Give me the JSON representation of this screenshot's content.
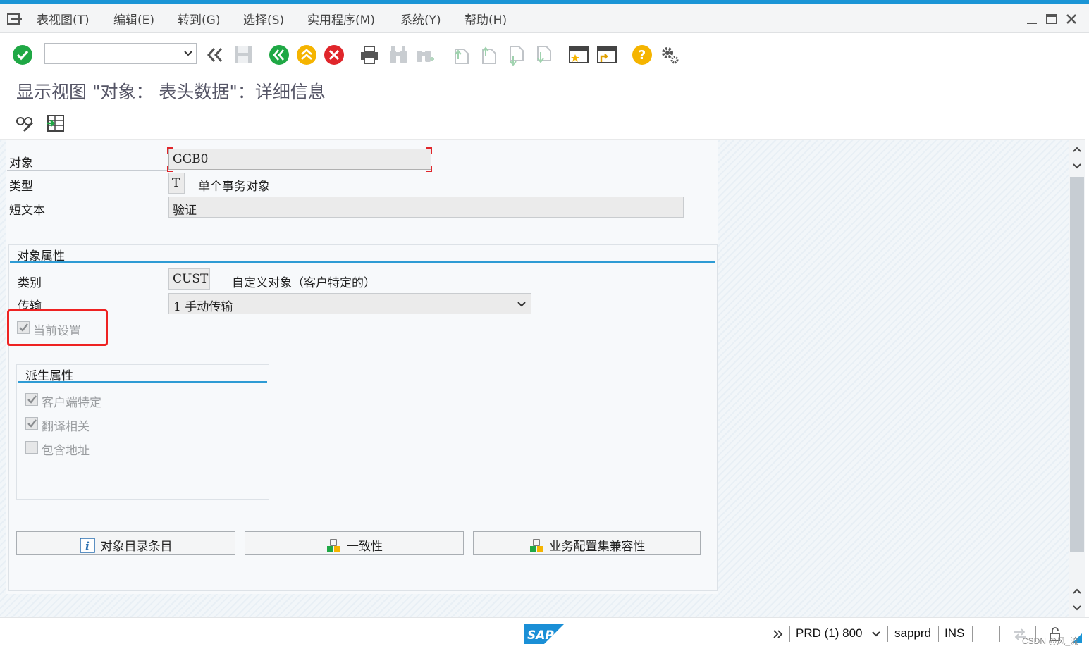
{
  "menu": {
    "items": [
      {
        "text": "表视图(",
        "key": "T",
        "tail": ")"
      },
      {
        "text": "编辑(",
        "key": "E",
        "tail": ")"
      },
      {
        "text": "转到(",
        "key": "G",
        "tail": ")"
      },
      {
        "text": "选择(",
        "key": "S",
        "tail": ")"
      },
      {
        "text": "实用程序(",
        "key": "M",
        "tail": ")"
      },
      {
        "text": "系统(",
        "key": "Y",
        "tail": ")"
      },
      {
        "text": "帮助(",
        "key": "H",
        "tail": ")"
      }
    ]
  },
  "toolbar": {
    "command_value": "",
    "icons": [
      "enter-icon",
      "back-double-icon",
      "save-icon",
      "back-icon",
      "exit-icon",
      "cancel-icon",
      "print-icon",
      "find-icon",
      "find-next-icon",
      "first-page-icon",
      "previous-page-icon",
      "next-page-icon",
      "last-page-icon",
      "create-session-icon",
      "shortcut-icon",
      "help-icon",
      "settings-icon"
    ]
  },
  "title": "显示视图 \"对象： 表头数据\"：详细信息",
  "app_toolbar": {
    "icons": [
      "display-change-icon",
      "select-icon"
    ]
  },
  "header_fields": {
    "object_label": "对象",
    "object_value": "GGB0",
    "type_label": "类型",
    "type_value": "T",
    "type_desc": "单个事务对象",
    "short_text_label": "短文本",
    "short_text_value": "验证"
  },
  "object_attributes": {
    "title": "对象属性",
    "category_label": "类别",
    "category_value": "CUST",
    "category_desc": "自定义对象（客户特定的）",
    "transport_label": "传输",
    "transport_value": "1 手动传输",
    "current_setting_label": "当前设置",
    "current_setting_checked": true
  },
  "derived_attributes": {
    "title": "派生属性",
    "items": [
      {
        "label": "客户端特定",
        "checked": true
      },
      {
        "label": "翻译相关",
        "checked": true
      },
      {
        "label": "包含地址",
        "checked": false
      }
    ]
  },
  "buttons": {
    "catalog": "对象目录条目",
    "consistency": "一致性",
    "bc_set": "业务配置集兼容性"
  },
  "status": {
    "system": "PRD (1) 800",
    "server": "sapprd",
    "mode": "INS",
    "watermark": "CSDN @风_流"
  },
  "colors": {
    "accent": "#1a95d6",
    "group_line": "#2e9bd4",
    "highlight": "#ee2222",
    "enter_green": "#1fa845",
    "cancel_red": "#e0262b",
    "help_yellow": "#f5b400"
  }
}
